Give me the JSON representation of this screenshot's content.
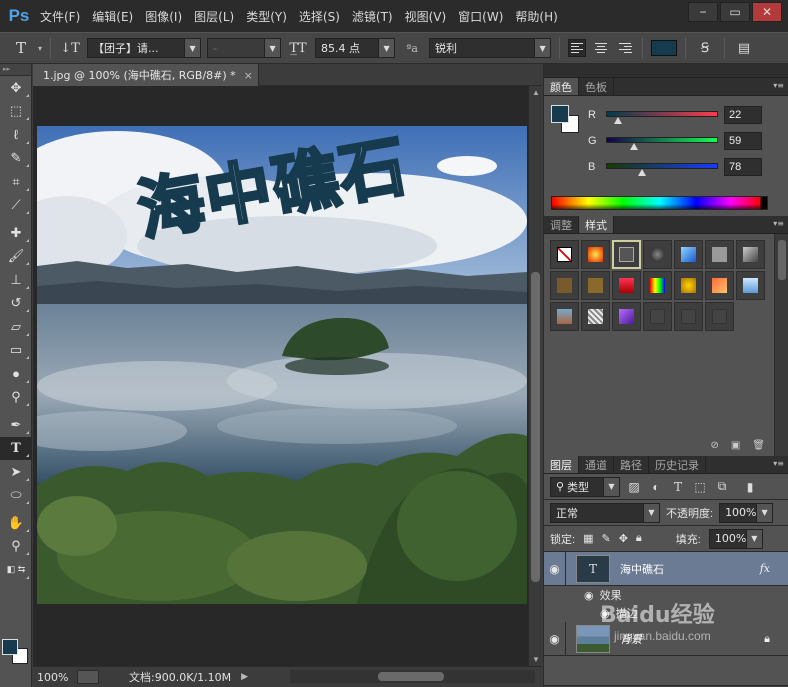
{
  "app": {
    "logo": "Ps",
    "menu": [
      "文件(F)",
      "编辑(E)",
      "图像(I)",
      "图层(L)",
      "类型(Y)",
      "选择(S)",
      "滤镜(T)",
      "视图(V)",
      "窗口(W)",
      "帮助(H)"
    ],
    "window_controls": [
      "minimize",
      "restore",
      "close"
    ]
  },
  "options": {
    "font_family": "【团子】请...",
    "font_style": "-",
    "font_size": "85.4 点",
    "antialias_icon": "ªa",
    "antialias": "锐利",
    "text_color": "#163b4e"
  },
  "document": {
    "tab_title": "1.jpg @ 100% (海中礁石, RGB/8#) *",
    "zoom": "100%",
    "doc_info": "文档:900.0K/1.10M",
    "overlay_text": "海中礁石"
  },
  "color_panel": {
    "tabs": [
      "颜色",
      "色板"
    ],
    "fg_color": "#163b4e",
    "bg_color": "#ffffff",
    "r": {
      "label": "R",
      "value": "22"
    },
    "g": {
      "label": "G",
      "value": "59"
    },
    "b": {
      "label": "B",
      "value": "78"
    }
  },
  "styles_panel": {
    "tabs": [
      "调整",
      "样式"
    ]
  },
  "layers_panel": {
    "tabs": [
      "图层",
      "通道",
      "路径",
      "历史记录"
    ],
    "filter": "类型",
    "blend_mode": "正常",
    "opacity_label": "不透明度:",
    "opacity_value": "100%",
    "lock_label": "锁定:",
    "fill_label": "填充:",
    "fill_value": "100%",
    "layers": [
      {
        "name": "海中礁石",
        "fx": "fx",
        "effect_label": "效果",
        "effect_item": "描边"
      },
      {
        "name": "背景"
      }
    ]
  },
  "watermark": {
    "text": "Baidu经验",
    "url": "jingyan.baidu.com"
  }
}
